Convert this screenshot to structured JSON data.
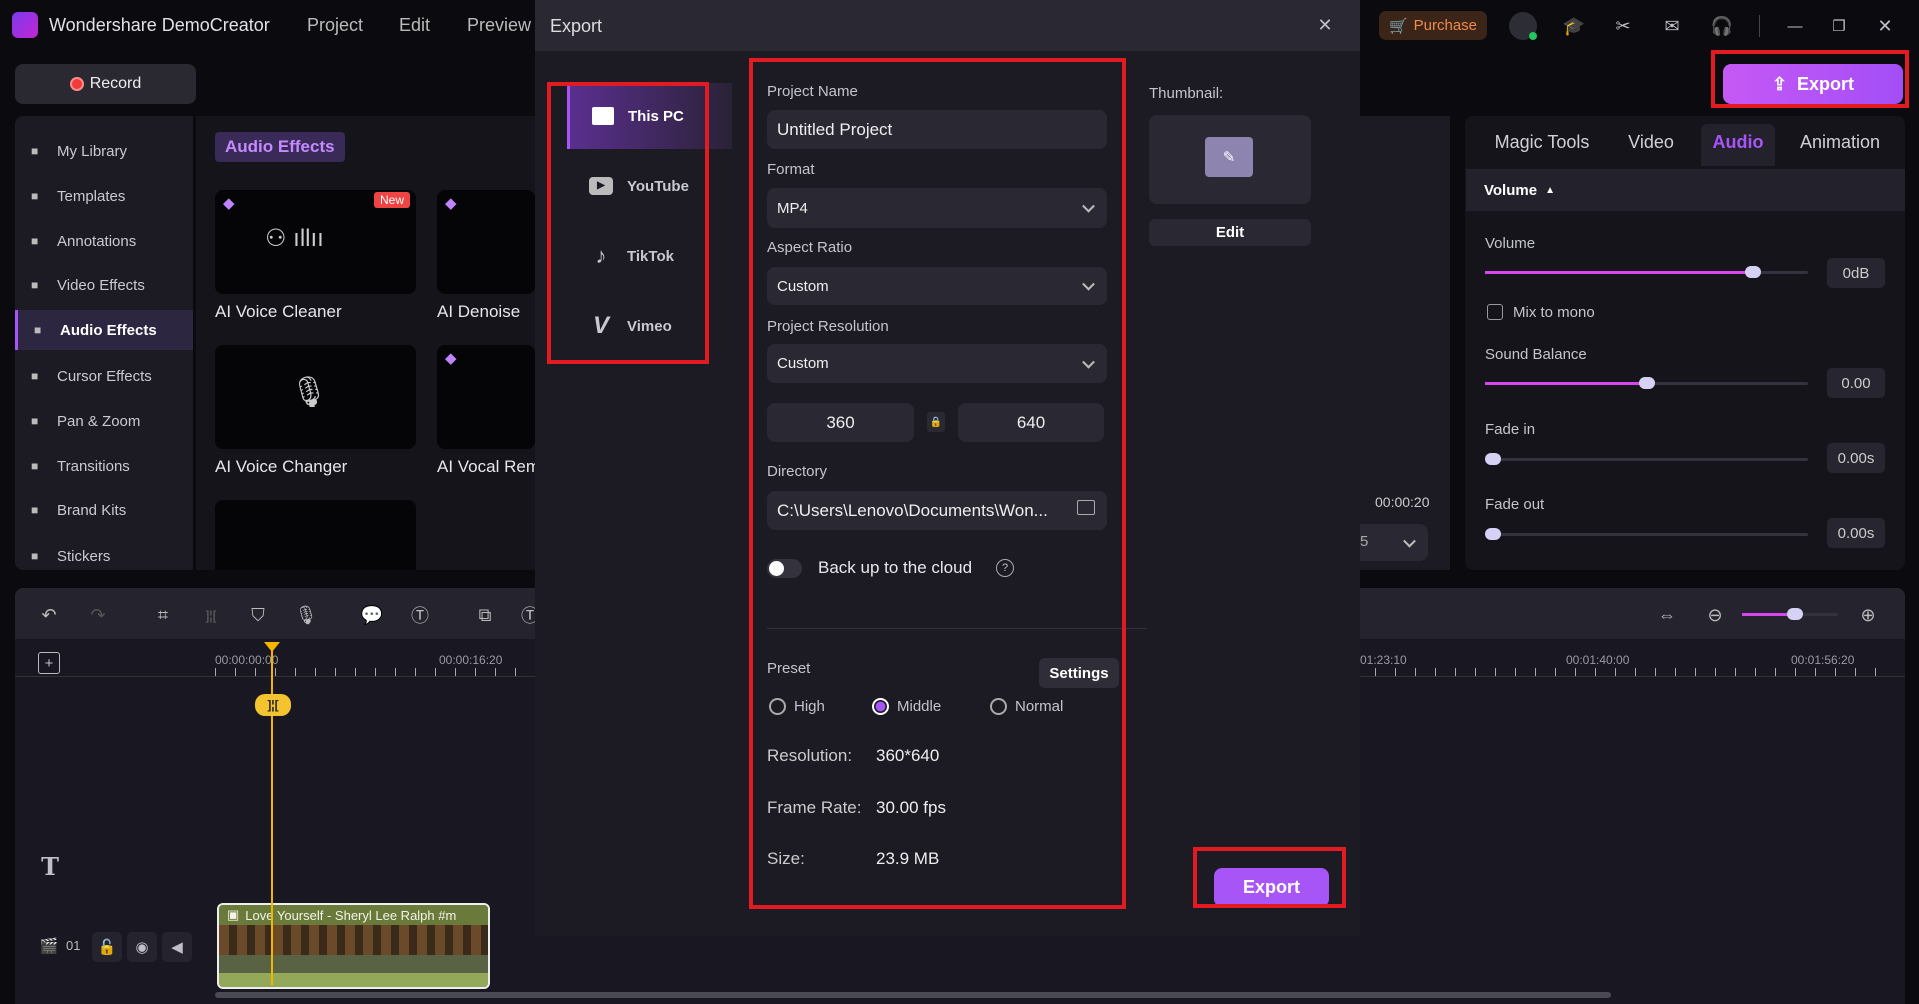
{
  "app": {
    "title": "Wondershare DemoCreator",
    "menu": [
      "Project",
      "Edit",
      "Preview"
    ],
    "purchase_label": "Purchase",
    "record_label": "Record",
    "export_label": "Export",
    "accent": "#a855f7",
    "highlight": "#e21b23"
  },
  "sidebar": {
    "items": [
      {
        "label": "My Library",
        "icon": "library-icon"
      },
      {
        "label": "Templates",
        "icon": "templates-icon"
      },
      {
        "label": "Annotations",
        "icon": "annotations-icon"
      },
      {
        "label": "Video Effects",
        "icon": "video-effects-icon"
      },
      {
        "label": "Audio Effects",
        "icon": "music-note-icon",
        "active": true
      },
      {
        "label": "Cursor Effects",
        "icon": "cursor-icon"
      },
      {
        "label": "Pan & Zoom",
        "icon": "pan-zoom-icon"
      },
      {
        "label": "Transitions",
        "icon": "transitions-icon"
      },
      {
        "label": "Brand Kits",
        "icon": "brand-kits-icon"
      },
      {
        "label": "Stickers",
        "icon": "stickers-icon"
      }
    ]
  },
  "library": {
    "title": "Audio Effects",
    "new_badge": "New",
    "cards": [
      "AI Voice Cleaner",
      "AI Denoise",
      "AI Voice Changer",
      "AI Vocal Rem"
    ]
  },
  "dialog": {
    "title": "Export",
    "destinations": [
      "This PC",
      "YouTube",
      "TikTok",
      "Vimeo"
    ],
    "project_name_label": "Project Name",
    "project_name": "Untitled Project",
    "format_label": "Format",
    "format": "MP4",
    "aspect_label": "Aspect Ratio",
    "aspect": "Custom",
    "resolution_label": "Project Resolution",
    "resolution": "Custom",
    "width": "360",
    "height": "640",
    "directory_label": "Directory",
    "directory": "C:\\Users\\Lenovo\\Documents\\Won...",
    "backup_label": "Back up to the cloud",
    "backup_on": false,
    "preset_label": "Preset",
    "settings_label": "Settings",
    "presets": [
      "High",
      "Middle",
      "Normal"
    ],
    "preset_selected": "Middle",
    "info": [
      {
        "k": "Resolution:",
        "v": "360*640"
      },
      {
        "k": "Frame Rate:",
        "v": "30.00 fps"
      },
      {
        "k": "Size:",
        "v": "23.9 MB"
      }
    ],
    "thumbnail_label": "Thumbnail:",
    "edit_label": "Edit",
    "export_label": "Export"
  },
  "right_panel": {
    "tabs": [
      "Magic Tools",
      "Video",
      "Audio",
      "Animation"
    ],
    "active_tab": "Audio",
    "section": "Volume",
    "volume_label": "Volume",
    "volume_value": "0dB",
    "volume_level": 0.83,
    "mix_mono_label": "Mix to mono",
    "mix_mono": false,
    "balance_label": "Sound Balance",
    "balance_value": "0.00",
    "balance_level": 0.5,
    "fade_in_label": "Fade in",
    "fade_in_value": "0.00s",
    "fade_out_label": "Fade out",
    "fade_out_value": "0.00s"
  },
  "preview": {
    "time": "00:00:20",
    "zoom_partial": "5"
  },
  "timeline": {
    "ruler": [
      "00:00:00:00",
      "00:00:16:20",
      "01:23:10",
      "00:01:40:00",
      "00:01:56:20"
    ],
    "track_number": "01",
    "clip_title": "Love Yourself - Sheryl Lee Ralph #m",
    "zoom_level": 0.55
  }
}
